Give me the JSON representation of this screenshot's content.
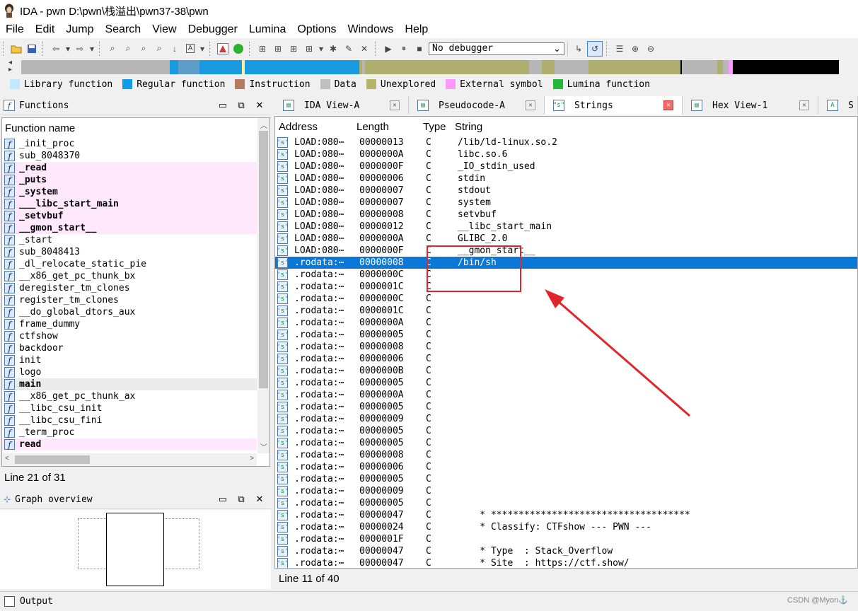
{
  "window": {
    "title": "IDA - pwn D:\\pwn\\栈溢出\\pwn37-38\\pwn"
  },
  "menu": [
    "File",
    "Edit",
    "Jump",
    "Search",
    "View",
    "Debugger",
    "Lumina",
    "Options",
    "Windows",
    "Help"
  ],
  "toolbar": {
    "debugger_select": "No debugger"
  },
  "navbar_segments": [
    {
      "color": "#b7b7b7",
      "w": 210
    },
    {
      "color": "#1a9be0",
      "w": 12
    },
    {
      "color": "#5c9ec9",
      "w": 30
    },
    {
      "color": "#1a9be0",
      "w": 60
    },
    {
      "color": "#ffef9a",
      "w": 4
    },
    {
      "color": "#1a9be0",
      "w": 162
    },
    {
      "color": "#aeae6e",
      "w": 4
    },
    {
      "color": "#b7b7b7",
      "w": 4
    },
    {
      "color": "#aeae6e",
      "w": 232
    },
    {
      "color": "#b7b7b7",
      "w": 18
    },
    {
      "color": "#aeae6e",
      "w": 18
    },
    {
      "color": "#b7b7b7",
      "w": 48
    },
    {
      "color": "#aeae6e",
      "w": 130
    },
    {
      "color": "#000000",
      "w": 2
    },
    {
      "color": "#b7b7b7",
      "w": 50
    },
    {
      "color": "#aeae6e",
      "w": 8
    },
    {
      "color": "#b7b7b7",
      "w": 8
    },
    {
      "color": "#ff99ff",
      "w": 6
    },
    {
      "color": "#000000",
      "w": 150
    }
  ],
  "legend": [
    {
      "label": "Library function",
      "color": "#bfe9ff"
    },
    {
      "label": "Regular function",
      "color": "#0f9de8"
    },
    {
      "label": "Instruction",
      "color": "#b57c5e"
    },
    {
      "label": "Data",
      "color": "#c0c0c0"
    },
    {
      "label": "Unexplored",
      "color": "#b5b56a"
    },
    {
      "label": "External symbol",
      "color": "#ff99ff"
    },
    {
      "label": "Lumina function",
      "color": "#22b83a"
    }
  ],
  "functions_panel": {
    "title": "Functions",
    "column": "Function name",
    "items": [
      {
        "name": "_init_proc",
        "kind": "normal"
      },
      {
        "name": "sub_8048370",
        "kind": "normal"
      },
      {
        "name": "_read",
        "kind": "lib"
      },
      {
        "name": "_puts",
        "kind": "lib"
      },
      {
        "name": "_system",
        "kind": "lib"
      },
      {
        "name": "___libc_start_main",
        "kind": "lib"
      },
      {
        "name": "_setvbuf",
        "kind": "lib"
      },
      {
        "name": "__gmon_start__",
        "kind": "lib"
      },
      {
        "name": "_start",
        "kind": "normal"
      },
      {
        "name": "sub_8048413",
        "kind": "normal"
      },
      {
        "name": "_dl_relocate_static_pie",
        "kind": "normal"
      },
      {
        "name": "__x86_get_pc_thunk_bx",
        "kind": "normal"
      },
      {
        "name": "deregister_tm_clones",
        "kind": "normal"
      },
      {
        "name": "register_tm_clones",
        "kind": "normal"
      },
      {
        "name": "__do_global_dtors_aux",
        "kind": "normal"
      },
      {
        "name": "frame_dummy",
        "kind": "normal"
      },
      {
        "name": "ctfshow",
        "kind": "normal"
      },
      {
        "name": "backdoor",
        "kind": "normal"
      },
      {
        "name": "init",
        "kind": "normal"
      },
      {
        "name": "logo",
        "kind": "normal"
      },
      {
        "name": "main",
        "kind": "selected"
      },
      {
        "name": "__x86_get_pc_thunk_ax",
        "kind": "normal"
      },
      {
        "name": "__libc_csu_init",
        "kind": "normal"
      },
      {
        "name": "__libc_csu_fini",
        "kind": "normal"
      },
      {
        "name": "_term_proc",
        "kind": "normal"
      },
      {
        "name": "read",
        "kind": "lib"
      }
    ],
    "status": "Line 21 of 31"
  },
  "graph_panel": {
    "title": "Graph overview"
  },
  "tabs": [
    {
      "label": "IDA View-A",
      "icon": "ida-view-icon",
      "active": false,
      "w": 190
    },
    {
      "label": "Pseudocode-A",
      "icon": "pseudocode-icon",
      "active": false,
      "w": 192
    },
    {
      "label": "Strings",
      "icon": "strings-icon",
      "active": true,
      "w": 195
    },
    {
      "label": "Hex View-1",
      "icon": "hex-view-icon",
      "active": false,
      "w": 192
    },
    {
      "label": "S",
      "icon": "structures-icon",
      "active": false,
      "w": 56
    }
  ],
  "strings_table": {
    "headers": [
      "Address",
      "Length",
      "Type",
      "String"
    ],
    "rows": [
      {
        "addr": "LOAD:080⋯",
        "len": "00000013",
        "type": "C",
        "str": "/lib/ld-linux.so.2"
      },
      {
        "addr": "LOAD:080⋯",
        "len": "0000000A",
        "type": "C",
        "str": "libc.so.6"
      },
      {
        "addr": "LOAD:080⋯",
        "len": "0000000F",
        "type": "C",
        "str": "_IO_stdin_used"
      },
      {
        "addr": "LOAD:080⋯",
        "len": "00000006",
        "type": "C",
        "str": "stdin"
      },
      {
        "addr": "LOAD:080⋯",
        "len": "00000007",
        "type": "C",
        "str": "stdout"
      },
      {
        "addr": "LOAD:080⋯",
        "len": "00000007",
        "type": "C",
        "str": "system"
      },
      {
        "addr": "LOAD:080⋯",
        "len": "00000008",
        "type": "C",
        "str": "setvbuf"
      },
      {
        "addr": "LOAD:080⋯",
        "len": "00000012",
        "type": "C",
        "str": "__libc_start_main"
      },
      {
        "addr": "LOAD:080⋯",
        "len": "0000000A",
        "type": "C",
        "str": "GLIBC_2.0"
      },
      {
        "addr": "LOAD:080⋯",
        "len": "0000000F",
        "type": "C",
        "str": "__gmon_start__"
      },
      {
        "addr": ".rodata:⋯",
        "len": "00000008",
        "type": "C",
        "str": "/bin/sh",
        "selected": true
      },
      {
        "addr": ".rodata:⋯",
        "len": "0000000C",
        "type": "C",
        "str": ""
      },
      {
        "addr": ".rodata:⋯",
        "len": "0000001C",
        "type": "C",
        "str": ""
      },
      {
        "addr": ".rodata:⋯",
        "len": "0000000C",
        "type": "C",
        "str": ""
      },
      {
        "addr": ".rodata:⋯",
        "len": "0000001C",
        "type": "C",
        "str": ""
      },
      {
        "addr": ".rodata:⋯",
        "len": "0000000A",
        "type": "C",
        "str": ""
      },
      {
        "addr": ".rodata:⋯",
        "len": "00000005",
        "type": "C",
        "str": ""
      },
      {
        "addr": ".rodata:⋯",
        "len": "00000008",
        "type": "C",
        "str": ""
      },
      {
        "addr": ".rodata:⋯",
        "len": "00000006",
        "type": "C",
        "str": ""
      },
      {
        "addr": ".rodata:⋯",
        "len": "0000000B",
        "type": "C",
        "str": ""
      },
      {
        "addr": ".rodata:⋯",
        "len": "00000005",
        "type": "C",
        "str": ""
      },
      {
        "addr": ".rodata:⋯",
        "len": "0000000A",
        "type": "C",
        "str": ""
      },
      {
        "addr": ".rodata:⋯",
        "len": "00000005",
        "type": "C",
        "str": ""
      },
      {
        "addr": ".rodata:⋯",
        "len": "00000009",
        "type": "C",
        "str": ""
      },
      {
        "addr": ".rodata:⋯",
        "len": "00000005",
        "type": "C",
        "str": ""
      },
      {
        "addr": ".rodata:⋯",
        "len": "00000005",
        "type": "C",
        "str": ""
      },
      {
        "addr": ".rodata:⋯",
        "len": "00000008",
        "type": "C",
        "str": ""
      },
      {
        "addr": ".rodata:⋯",
        "len": "00000006",
        "type": "C",
        "str": ""
      },
      {
        "addr": ".rodata:⋯",
        "len": "00000005",
        "type": "C",
        "str": ""
      },
      {
        "addr": ".rodata:⋯",
        "len": "00000009",
        "type": "C",
        "str": ""
      },
      {
        "addr": ".rodata:⋯",
        "len": "00000005",
        "type": "C",
        "str": ""
      },
      {
        "addr": ".rodata:⋯",
        "len": "00000047",
        "type": "C",
        "str": "    * ************************************"
      },
      {
        "addr": ".rodata:⋯",
        "len": "00000024",
        "type": "C",
        "str": "    * Classify: CTFshow --- PWN ---"
      },
      {
        "addr": ".rodata:⋯",
        "len": "0000001F",
        "type": "C",
        "str": ""
      },
      {
        "addr": ".rodata:⋯",
        "len": "00000047",
        "type": "C",
        "str": "    * Type  : Stack_Overflow"
      },
      {
        "addr": ".rodata:⋯",
        "len": "00000047",
        "type": "C",
        "str": "    * Site  : https://ctf.show/"
      }
    ],
    "status": "Line 11 of 40"
  },
  "output_panel": {
    "title": "Output"
  },
  "watermark": "CSDN @Myon⚓"
}
